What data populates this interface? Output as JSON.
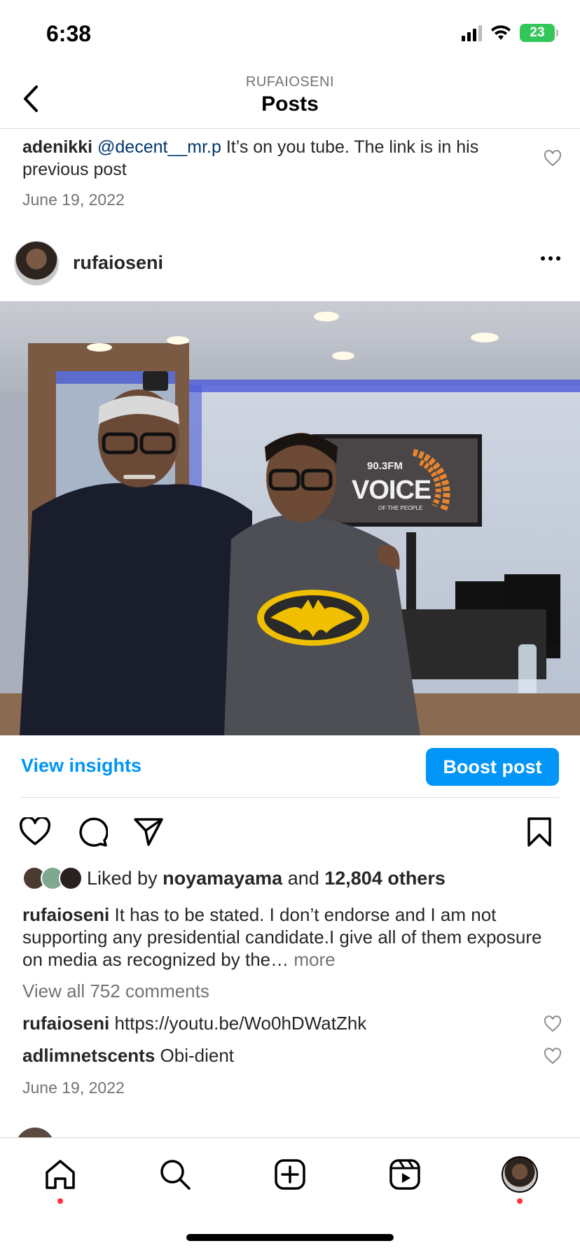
{
  "status_bar": {
    "time": "6:38",
    "battery": "23"
  },
  "header": {
    "account": "RUFAIOSENI",
    "title": "Posts"
  },
  "previous_comment": {
    "username": "adenikki",
    "mention": "@decent__mr.p",
    "text": " It’s on you tube. The link is in his previous post",
    "date": "June 19, 2022"
  },
  "post": {
    "username": "rufaioseni",
    "photo": {
      "screen_label": "90.3FM",
      "screen_title": "VOICE",
      "screen_subtitle": "OF THE PEOPLE"
    },
    "view_insights_label": "View insights",
    "boost_label": "Boost post",
    "likes": {
      "prefix": "Liked by ",
      "liker": "noyamayama",
      "middle": " and ",
      "count": "12,804 others"
    },
    "caption": {
      "username": "rufaioseni",
      "text": " It has to be stated. I don’t endorse and I am not supporting any presidential candidate.I give all of them exposure on media as recognized by the…",
      "more": " more"
    },
    "view_comments": "View all 752 comments",
    "comments": [
      {
        "username": "rufaioseni",
        "text": " https://youtu.be/Wo0hDWatZhk"
      },
      {
        "username": "adlimnetscents",
        "text": " Obi-dient"
      }
    ],
    "date": "June 19, 2022"
  },
  "nav": {
    "items": [
      "home-icon",
      "search-icon",
      "create-icon",
      "reels-icon",
      "profile-avatar"
    ]
  },
  "colors": {
    "accent": "#0095f6",
    "notification": "#ff3040",
    "text": "#262626",
    "muted": "#737373"
  }
}
